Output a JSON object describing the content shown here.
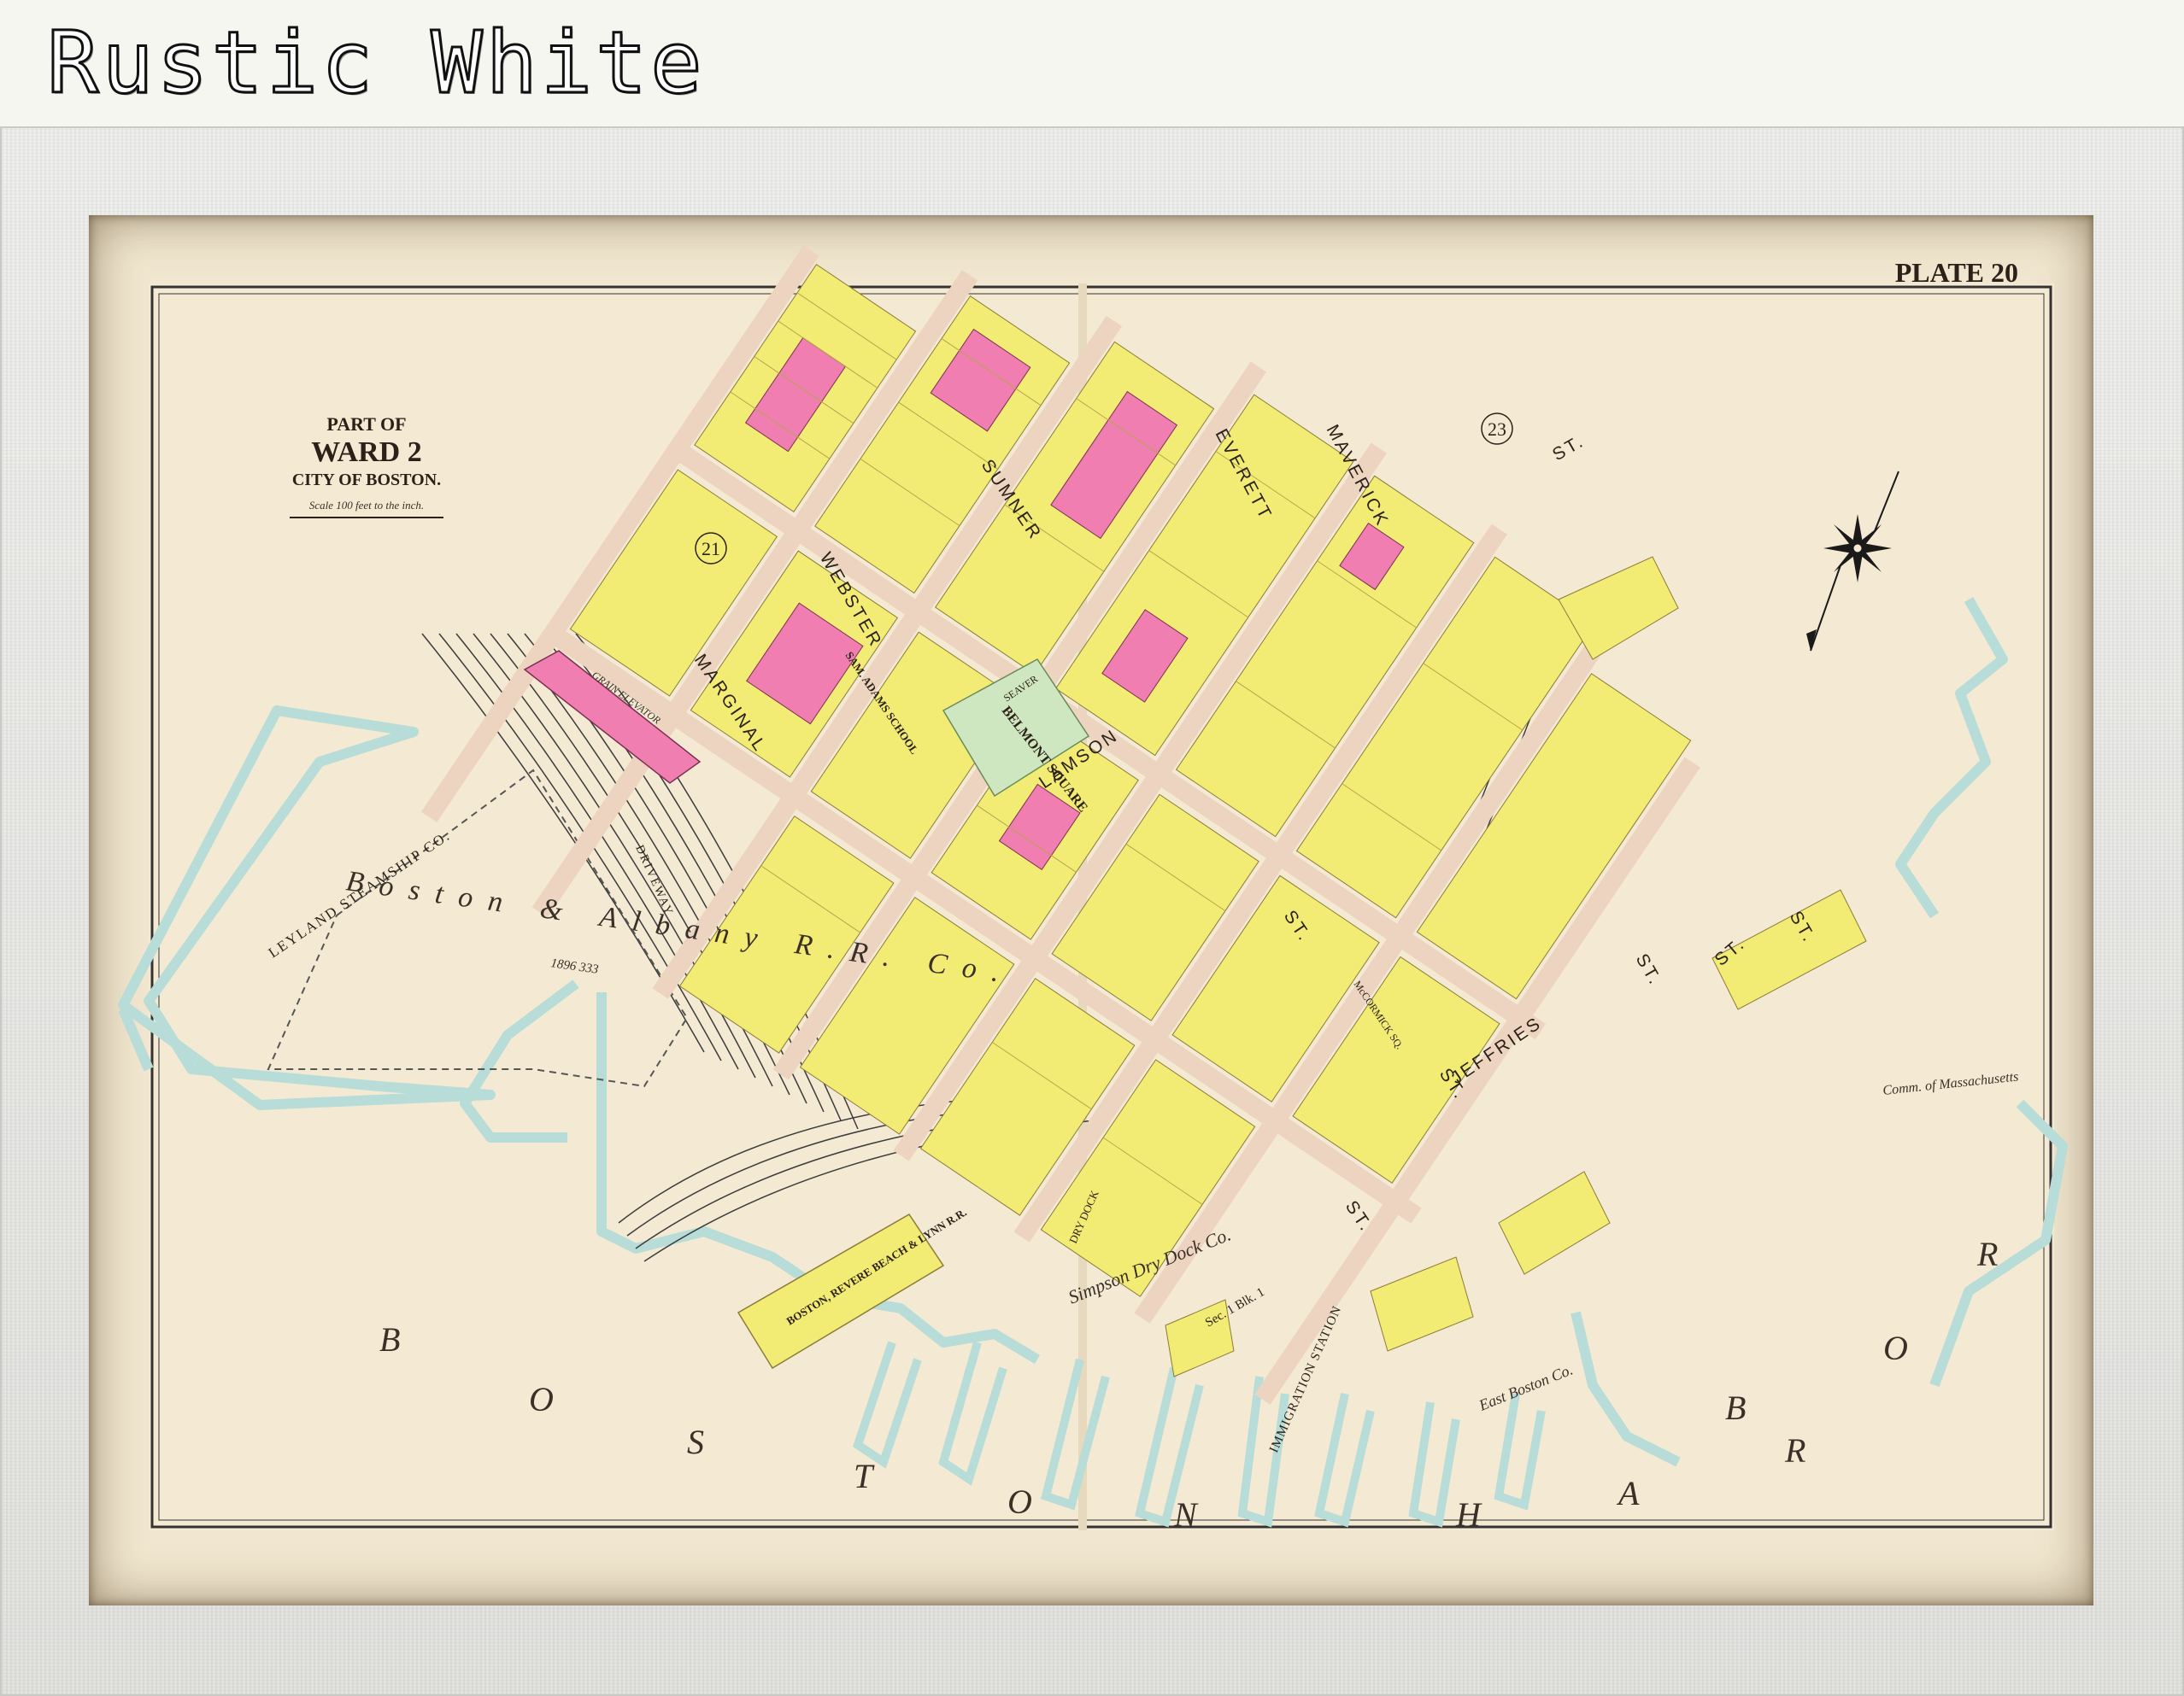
{
  "banner": {
    "title": "Rustic White"
  },
  "map": {
    "plate": "PLATE 20",
    "title_block": {
      "part_of": "PART OF",
      "ward": "WARD 2",
      "city": "CITY OF BOSTON.",
      "scale": "Scale 100 feet to the inch."
    },
    "ward_numbers": [
      "21",
      "23"
    ],
    "streets": {
      "maverick": "MAVERICK",
      "everett": "EVERETT",
      "sumner": "SUMNER",
      "webster": "WEBSTER",
      "marginal": "MARGINAL",
      "lamson": "LAMSON",
      "jeffries": "JEFFRIES",
      "st": "ST.",
      "seaver": "SEAVER",
      "mccormick": "McCORMICK SQ."
    },
    "places": {
      "belmont_square": "BELMONT SQUARE",
      "railroad": "Boston & Albany R.R. Co.",
      "rr_area": "1896 333",
      "leyland": "LEYLAND STEAMSHIP CO.",
      "driveway": "DRIVEWAY",
      "brbl": "BOSTON, REVERE BEACH & LYNN R.R.",
      "grain_elevator": "GRAIN ELEVATOR",
      "sam_adams_school": "SAM. ADAMS SCHOOL",
      "simpson_dry_dock": "Simpson Dry Dock Co.",
      "dry_dock": "DRY DOCK",
      "immigration": "IMMIGRATION STATION",
      "east_boston_co": "East Boston Co.",
      "commonwealth": "Comm. of Massachusetts",
      "sec": "Sec. 1 Blk. 1"
    },
    "harbor_letters": {
      "boston": [
        "B",
        "O",
        "S",
        "T",
        "O",
        "N"
      ],
      "harbor": [
        "H",
        "A",
        "R",
        "B",
        "O",
        "R"
      ]
    }
  },
  "colors": {
    "paper": "#f4ead3",
    "water": "#b8dcd8",
    "yellow": "#f3ec74",
    "pink": "#f07eb0",
    "green": "#cfe7c1",
    "street": "#ecd4c0"
  }
}
